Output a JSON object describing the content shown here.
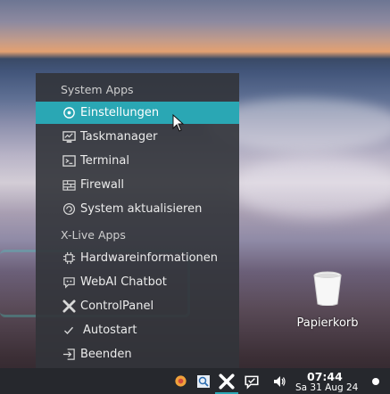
{
  "menu": {
    "section_system": "System Apps",
    "section_xlive": "X-Live Apps",
    "items": [
      {
        "label": "Einstellungen",
        "icon": "settings-icon"
      },
      {
        "label": "Taskmanager",
        "icon": "task-manager-icon"
      },
      {
        "label": "Terminal",
        "icon": "terminal-icon"
      },
      {
        "label": "Firewall",
        "icon": "firewall-icon"
      },
      {
        "label": "System aktualisieren",
        "icon": "update-icon"
      },
      {
        "label": "Hardwareinformationen",
        "icon": "hardware-chip-icon"
      },
      {
        "label": "WebAI Chatbot",
        "icon": "chatbot-icon"
      },
      {
        "label": "ControlPanel",
        "icon": "control-panel-icon"
      },
      {
        "label": "Autostart",
        "icon": "checkmark-icon"
      },
      {
        "label": "Beenden",
        "icon": "exit-icon"
      }
    ],
    "highlighted": "Einstellungen",
    "accent_color": "#2aa7b4"
  },
  "desktop": {
    "trash_label": "Papierkorb"
  },
  "taskbar": {
    "clock_time": "07:44",
    "clock_date": "Sa 31 Aug 24"
  }
}
